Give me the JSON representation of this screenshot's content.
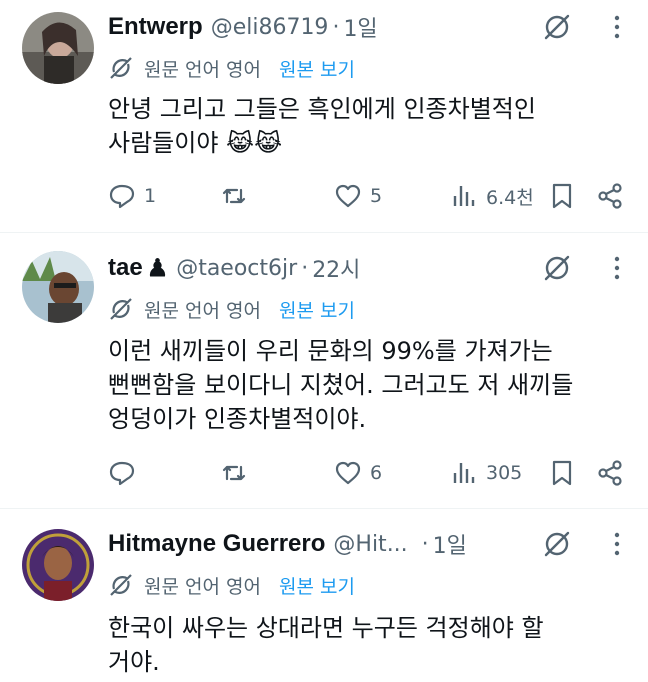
{
  "translation": {
    "label": "원문 언어 영어",
    "link": "원본 보기"
  },
  "tweets": [
    {
      "name": "Entwerp",
      "handle": "@eli86719",
      "sep": "·",
      "time": "1일",
      "line1": "안녕 그리고 그들은 흑인에게 인종차별적인",
      "line2": "사람들이야 😹😹",
      "replies": "1",
      "retweets": "",
      "likes": "5",
      "views": "6.4천"
    },
    {
      "name": "tae",
      "name_emoji": "♟",
      "handle": "@taeoct6jr",
      "sep": "·",
      "time": "22시",
      "line1": "이런 새끼들이 우리 문화의 99%를 가져가는",
      "line2": "뻔뻔함을 보이다니 지쳤어. 그러고도 저 새끼들",
      "line3": "엉덩이가 인종차별적이야.",
      "replies": "",
      "retweets": "",
      "likes": "6",
      "views": "305"
    },
    {
      "name": "Hitmayne Guerrero",
      "handle": "@Hit...",
      "sep": "·",
      "time": "1일",
      "line1": "한국이 싸우는 상대라면 누구든 걱정해야 할",
      "line2": "거야."
    }
  ],
  "colors": {
    "text": "#0f1419",
    "muted": "#536471",
    "link": "#1d9bf0",
    "divider": "#eff3f4"
  },
  "icons": [
    "grok-icon",
    "more-icon",
    "translate-icon",
    "reply-icon",
    "retweet-icon",
    "like-icon",
    "views-icon",
    "bookmark-icon",
    "share-icon"
  ]
}
